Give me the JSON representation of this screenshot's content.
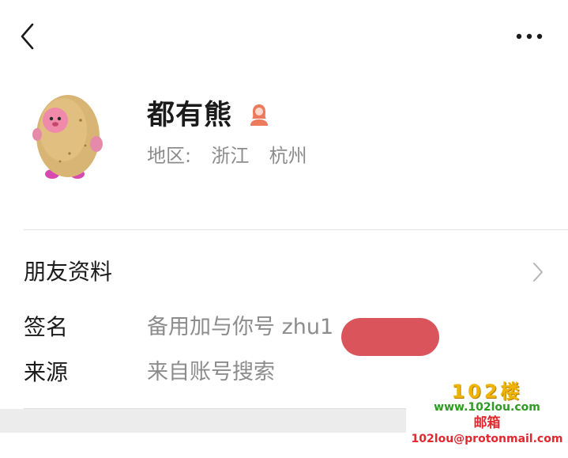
{
  "header": {
    "back_icon": "chevron-left-icon",
    "more_icon": "more-horizontal-icon"
  },
  "profile": {
    "name": "都有熊",
    "gender_icon": "female-user-icon",
    "gender_color": "#ec7a5c",
    "region_label": "地区:",
    "region_province": "浙江",
    "region_city": "杭州"
  },
  "rows": {
    "friend_info_label": "朋友资料",
    "signature_label": "签名",
    "signature_value": "备用加与你号 zhu1",
    "source_label": "来源",
    "source_value": "来自账号搜索"
  },
  "watermark": {
    "title": "102楼",
    "site": "www.102lou.com",
    "mail_label": "邮箱",
    "email": "102lou@protonmail.com"
  },
  "colors": {
    "redaction": "#d9555b",
    "secondary_text": "#8c8c8c",
    "watermark_yellow": "#f0b400",
    "watermark_green": "#2f9a24",
    "watermark_red": "#e0282e"
  }
}
